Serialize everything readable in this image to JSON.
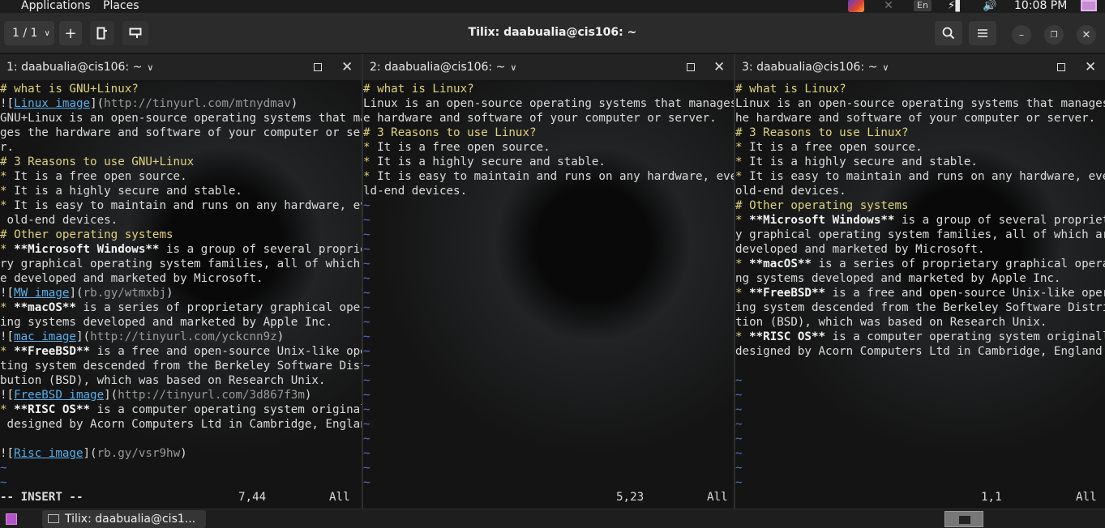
{
  "top_panel": {
    "applications_label": "Applications",
    "places_label": "Places",
    "keyboard_layout": "En",
    "clock": "10:08 PM"
  },
  "header": {
    "session_counter": "1 / 1",
    "title": "Tilix: daabualia@cis106: ~",
    "add_glyph": "+"
  },
  "panes": [
    {
      "title": "1: daabualia@cis106: ~",
      "lines": [
        [
          {
            "t": "# what is GNU+Linux?",
            "c": "hd"
          }
        ],
        [
          {
            "t": "!["
          },
          {
            "t": "Linux image",
            "c": "lnk"
          },
          {
            "t": "]("
          },
          {
            "t": "http://tinyurl.com/mtnydmav",
            "c": "url"
          },
          {
            "t": ")"
          }
        ],
        [
          {
            "t": "GNU+Linux is an open-source operating systems that mana"
          }
        ],
        [
          {
            "t": "ges the hardware and software of your computer or serve"
          }
        ],
        [
          {
            "t": "r."
          }
        ],
        [
          {
            "t": "# 3 Reasons to use GNU+Linux",
            "c": "hd"
          }
        ],
        [
          {
            "t": "*",
            "c": "bul"
          },
          {
            "t": " It is a free open source."
          }
        ],
        [
          {
            "t": "*",
            "c": "bul"
          },
          {
            "t": " It is a highly secure and stable."
          }
        ],
        [
          {
            "t": "*",
            "c": "bul"
          },
          {
            "t": " It is easy to maintain and runs on any hardware, even"
          }
        ],
        [
          {
            "t": " old-end devices."
          }
        ],
        [
          {
            "t": "# Other operating systems",
            "c": "hd"
          }
        ],
        [
          {
            "t": "*",
            "c": "bul"
          },
          {
            "t": " "
          },
          {
            "t": "**Microsoft Windows**",
            "c": "b"
          },
          {
            "t": " is a group of several proprieta"
          }
        ],
        [
          {
            "t": "ry graphical operating system families, all of which ar"
          }
        ],
        [
          {
            "t": "e developed and marketed by Microsoft."
          }
        ],
        [
          {
            "t": "!["
          },
          {
            "t": "MW image",
            "c": "lnk"
          },
          {
            "t": "]("
          },
          {
            "t": "rb.gy/wtmxbj",
            "c": "url"
          },
          {
            "t": ")"
          }
        ],
        [
          {
            "t": "*",
            "c": "bul"
          },
          {
            "t": " "
          },
          {
            "t": "**macOS**",
            "c": "b"
          },
          {
            "t": " is a series of proprietary graphical operat"
          }
        ],
        [
          {
            "t": "ing systems developed and marketed by Apple Inc."
          }
        ],
        [
          {
            "t": "!["
          },
          {
            "t": "mac image",
            "c": "lnk"
          },
          {
            "t": "]("
          },
          {
            "t": "http://tinyurl.com/yckcnn9z",
            "c": "url"
          },
          {
            "t": ")"
          }
        ],
        [
          {
            "t": "*",
            "c": "bul"
          },
          {
            "t": " "
          },
          {
            "t": "**FreeBSD**",
            "c": "b"
          },
          {
            "t": " is a free and open-source Unix-like opera"
          }
        ],
        [
          {
            "t": "ting system descended from the Berkeley Software Distri"
          }
        ],
        [
          {
            "t": "bution (BSD), which was based on Research Unix."
          }
        ],
        [
          {
            "t": "!["
          },
          {
            "t": "FreeBSD image",
            "c": "lnk"
          },
          {
            "t": "]("
          },
          {
            "t": "http://tinyurl.com/3d867f3m",
            "c": "url"
          },
          {
            "t": ")"
          }
        ],
        [
          {
            "t": "*",
            "c": "bul"
          },
          {
            "t": " "
          },
          {
            "t": "**RISC OS**",
            "c": "b"
          },
          {
            "t": " is a computer operating system originally"
          }
        ],
        [
          {
            "t": " designed by Acorn Computers Ltd in Cambridge, England."
          }
        ],
        [
          {
            "t": ""
          }
        ],
        [
          {
            "t": "!["
          },
          {
            "t": "Risc image",
            "c": "lnk"
          },
          {
            "t": "]("
          },
          {
            "t": "rb.gy/vsr9hw",
            "c": "url"
          },
          {
            "t": ")"
          }
        ],
        [
          {
            "t": "~",
            "c": "tilde"
          }
        ],
        [
          {
            "t": "~",
            "c": "tilde"
          }
        ]
      ],
      "mode": "-- INSERT --",
      "position": "7,44",
      "scroll": "All"
    },
    {
      "title": "2: daabualia@cis106: ~",
      "lines": [
        [
          {
            "t": "# what is Linux?",
            "c": "hd"
          }
        ],
        [
          {
            "t": "Linux is an open-source operating systems that manages th"
          }
        ],
        [
          {
            "t": "e hardware and software of your computer or server."
          }
        ],
        [
          {
            "t": "# 3 Reasons to use Linux?",
            "c": "hd"
          }
        ],
        [
          {
            "t": "*",
            "c": "bul"
          },
          {
            "t": " It is a free open source."
          }
        ],
        [
          {
            "t": "*",
            "c": "bul"
          },
          {
            "t": " It is a highly secure and stable."
          }
        ],
        [
          {
            "t": "*",
            "c": "bul"
          },
          {
            "t": " It is easy to maintain and runs on any hardware, even o"
          }
        ],
        [
          {
            "t": "ld-end devices."
          }
        ],
        [
          {
            "t": "~",
            "c": "tilde"
          }
        ],
        [
          {
            "t": "~",
            "c": "tilde"
          }
        ],
        [
          {
            "t": "~",
            "c": "tilde"
          }
        ],
        [
          {
            "t": "~",
            "c": "tilde"
          }
        ],
        [
          {
            "t": "~",
            "c": "tilde"
          }
        ],
        [
          {
            "t": "~",
            "c": "tilde"
          }
        ],
        [
          {
            "t": "~",
            "c": "tilde"
          }
        ],
        [
          {
            "t": "~",
            "c": "tilde"
          }
        ],
        [
          {
            "t": "~",
            "c": "tilde"
          }
        ],
        [
          {
            "t": "~",
            "c": "tilde"
          }
        ],
        [
          {
            "t": "~",
            "c": "tilde"
          }
        ],
        [
          {
            "t": "~",
            "c": "tilde"
          }
        ],
        [
          {
            "t": "~",
            "c": "tilde"
          }
        ],
        [
          {
            "t": "~",
            "c": "tilde"
          }
        ],
        [
          {
            "t": "~",
            "c": "tilde"
          }
        ],
        [
          {
            "t": "~",
            "c": "tilde"
          }
        ],
        [
          {
            "t": "~",
            "c": "tilde"
          }
        ],
        [
          {
            "t": "~",
            "c": "tilde"
          }
        ],
        [
          {
            "t": "~",
            "c": "tilde"
          }
        ],
        [
          {
            "t": "~",
            "c": "tilde"
          }
        ]
      ],
      "mode": "",
      "position": "5,23",
      "scroll": "All"
    },
    {
      "title": "3: daabualia@cis106: ~",
      "lines": [
        [
          {
            "t": "# what is Linux?",
            "c": "hd"
          }
        ],
        [
          {
            "t": "Linux is an open-source operating systems that manages t"
          }
        ],
        [
          {
            "t": "he hardware and software of your computer or server."
          }
        ],
        [
          {
            "t": "# 3 Reasons to use Linux?",
            "c": "hd"
          }
        ],
        [
          {
            "t": "*",
            "c": "bul"
          },
          {
            "t": " It is a free open source."
          }
        ],
        [
          {
            "t": "*",
            "c": "bul"
          },
          {
            "t": " It is a highly secure and stable."
          }
        ],
        [
          {
            "t": "*",
            "c": "bul"
          },
          {
            "t": " It is easy to maintain and runs on any hardware, even"
          }
        ],
        [
          {
            "t": "old-end devices."
          }
        ],
        [
          {
            "t": "# Other operating systems",
            "c": "hd"
          }
        ],
        [
          {
            "t": "*",
            "c": "bul"
          },
          {
            "t": " "
          },
          {
            "t": "**Microsoft Windows**",
            "c": "b"
          },
          {
            "t": " is a group of several proprietar"
          }
        ],
        [
          {
            "t": "y graphical operating system families, all of which are"
          }
        ],
        [
          {
            "t": "developed and marketed by Microsoft."
          }
        ],
        [
          {
            "t": "*",
            "c": "bul"
          },
          {
            "t": " "
          },
          {
            "t": "**macOS**",
            "c": "b"
          },
          {
            "t": " is a series of proprietary graphical operati"
          }
        ],
        [
          {
            "t": "ng systems developed and marketed by Apple Inc."
          }
        ],
        [
          {
            "t": "*",
            "c": "bul"
          },
          {
            "t": " "
          },
          {
            "t": "**FreeBSD**",
            "c": "b"
          },
          {
            "t": " is a free and open-source Unix-like operat"
          }
        ],
        [
          {
            "t": "ing system descended from the Berkeley Software Distribu"
          }
        ],
        [
          {
            "t": "tion (BSD), which was based on Research Unix."
          }
        ],
        [
          {
            "t": "*",
            "c": "bul"
          },
          {
            "t": " "
          },
          {
            "t": "**RISC OS**",
            "c": "b"
          },
          {
            "t": " is a computer operating system originally"
          }
        ],
        [
          {
            "t": "designed by Acorn Computers Ltd in Cambridge, England."
          }
        ],
        [
          {
            "t": ""
          }
        ],
        [
          {
            "t": "~",
            "c": "tilde"
          }
        ],
        [
          {
            "t": "~",
            "c": "tilde"
          }
        ],
        [
          {
            "t": "~",
            "c": "tilde"
          }
        ],
        [
          {
            "t": "~",
            "c": "tilde"
          }
        ],
        [
          {
            "t": "~",
            "c": "tilde"
          }
        ],
        [
          {
            "t": "~",
            "c": "tilde"
          }
        ],
        [
          {
            "t": "~",
            "c": "tilde"
          }
        ],
        [
          {
            "t": "~",
            "c": "tilde"
          }
        ]
      ],
      "mode": "",
      "position": "1,1",
      "scroll": "All"
    }
  ],
  "taskbar": {
    "window_label": "Tilix: daabualia@cis1..."
  },
  "colors": {
    "heading": "#e0d37a",
    "link": "#5aaee8",
    "tilde": "#5a6fd0",
    "accent_purple": "#b554c8"
  }
}
